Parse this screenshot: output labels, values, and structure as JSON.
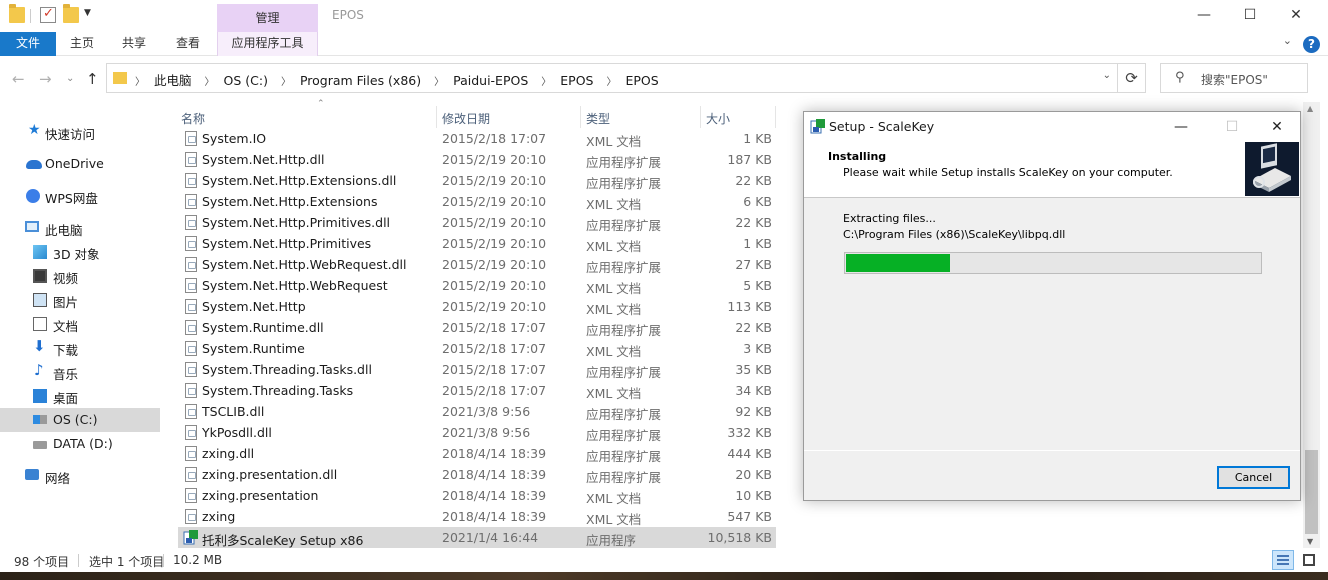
{
  "window": {
    "title": "EPOS",
    "manage_tab": "管理",
    "minimize": "—",
    "maximize": "☐",
    "close": "✕"
  },
  "ribbon": {
    "file": "文件",
    "home": "主页",
    "share": "共享",
    "view": "查看",
    "app_tools": "应用程序工具",
    "collapse": "⌄",
    "help": "?"
  },
  "nav": {
    "back": "←",
    "forward": "→",
    "recent": "⌄",
    "up": "↑",
    "crumbs": [
      "此电脑",
      "OS (C:)",
      "Program Files (x86)",
      "Paidui-EPOS",
      "EPOS",
      "EPOS"
    ],
    "refresh": "⟳",
    "search_placeholder": "搜索\"EPOS\""
  },
  "sidebar": [
    {
      "label": "快速访问",
      "icon": "star-icon"
    },
    {
      "label": "OneDrive",
      "icon": "cloud-icon"
    },
    {
      "label": "WPS网盘",
      "icon": "wps-icon"
    },
    {
      "label": "此电脑",
      "icon": "computer-icon"
    },
    {
      "label": "3D 对象",
      "icon": "cube-icon"
    },
    {
      "label": "视频",
      "icon": "video-icon"
    },
    {
      "label": "图片",
      "icon": "picture-icon"
    },
    {
      "label": "文档",
      "icon": "document-icon"
    },
    {
      "label": "下载",
      "icon": "download-icon"
    },
    {
      "label": "音乐",
      "icon": "music-icon"
    },
    {
      "label": "桌面",
      "icon": "desktop-icon"
    },
    {
      "label": "OS (C:)",
      "icon": "drive-icon"
    },
    {
      "label": "DATA (D:)",
      "icon": "drive-icon"
    },
    {
      "label": "网络",
      "icon": "network-icon"
    }
  ],
  "columns": {
    "name": "名称",
    "date": "修改日期",
    "type": "类型",
    "size": "大小"
  },
  "files": [
    {
      "name": "System.IO",
      "date": "2015/2/18 17:07",
      "type": "XML 文档",
      "size": "1 KB"
    },
    {
      "name": "System.Net.Http.dll",
      "date": "2015/2/19 20:10",
      "type": "应用程序扩展",
      "size": "187 KB"
    },
    {
      "name": "System.Net.Http.Extensions.dll",
      "date": "2015/2/19 20:10",
      "type": "应用程序扩展",
      "size": "22 KB"
    },
    {
      "name": "System.Net.Http.Extensions",
      "date": "2015/2/19 20:10",
      "type": "XML 文档",
      "size": "6 KB"
    },
    {
      "name": "System.Net.Http.Primitives.dll",
      "date": "2015/2/19 20:10",
      "type": "应用程序扩展",
      "size": "22 KB"
    },
    {
      "name": "System.Net.Http.Primitives",
      "date": "2015/2/19 20:10",
      "type": "XML 文档",
      "size": "1 KB"
    },
    {
      "name": "System.Net.Http.WebRequest.dll",
      "date": "2015/2/19 20:10",
      "type": "应用程序扩展",
      "size": "27 KB"
    },
    {
      "name": "System.Net.Http.WebRequest",
      "date": "2015/2/19 20:10",
      "type": "XML 文档",
      "size": "5 KB"
    },
    {
      "name": "System.Net.Http",
      "date": "2015/2/19 20:10",
      "type": "XML 文档",
      "size": "113 KB"
    },
    {
      "name": "System.Runtime.dll",
      "date": "2015/2/18 17:07",
      "type": "应用程序扩展",
      "size": "22 KB"
    },
    {
      "name": "System.Runtime",
      "date": "2015/2/18 17:07",
      "type": "XML 文档",
      "size": "3 KB"
    },
    {
      "name": "System.Threading.Tasks.dll",
      "date": "2015/2/18 17:07",
      "type": "应用程序扩展",
      "size": "35 KB"
    },
    {
      "name": "System.Threading.Tasks",
      "date": "2015/2/18 17:07",
      "type": "XML 文档",
      "size": "34 KB"
    },
    {
      "name": "TSCLIB.dll",
      "date": "2021/3/8 9:56",
      "type": "应用程序扩展",
      "size": "92 KB"
    },
    {
      "name": "YkPosdll.dll",
      "date": "2021/3/8 9:56",
      "type": "应用程序扩展",
      "size": "332 KB"
    },
    {
      "name": "zxing.dll",
      "date": "2018/4/14 18:39",
      "type": "应用程序扩展",
      "size": "444 KB"
    },
    {
      "name": "zxing.presentation.dll",
      "date": "2018/4/14 18:39",
      "type": "应用程序扩展",
      "size": "20 KB"
    },
    {
      "name": "zxing.presentation",
      "date": "2018/4/14 18:39",
      "type": "XML 文档",
      "size": "10 KB"
    },
    {
      "name": "zxing",
      "date": "2018/4/14 18:39",
      "type": "XML 文档",
      "size": "547 KB"
    },
    {
      "name": "托利多ScaleKey Setup x86",
      "date": "2021/1/4 16:44",
      "type": "应用程序",
      "size": "10,518 KB"
    }
  ],
  "status": {
    "count": "98 个项目",
    "selected": "选中 1 个项目",
    "size": "10.2 MB"
  },
  "dialog": {
    "title": "Setup - ScaleKey",
    "heading": "Installing",
    "subheading": "Please wait while Setup installs ScaleKey on your computer.",
    "status": "Extracting files...",
    "path": "C:\\Program Files (x86)\\ScaleKey\\libpq.dll",
    "progress": 0.25,
    "cancel": "Cancel",
    "minimize": "—",
    "maximize": "☐",
    "close": "✕"
  }
}
